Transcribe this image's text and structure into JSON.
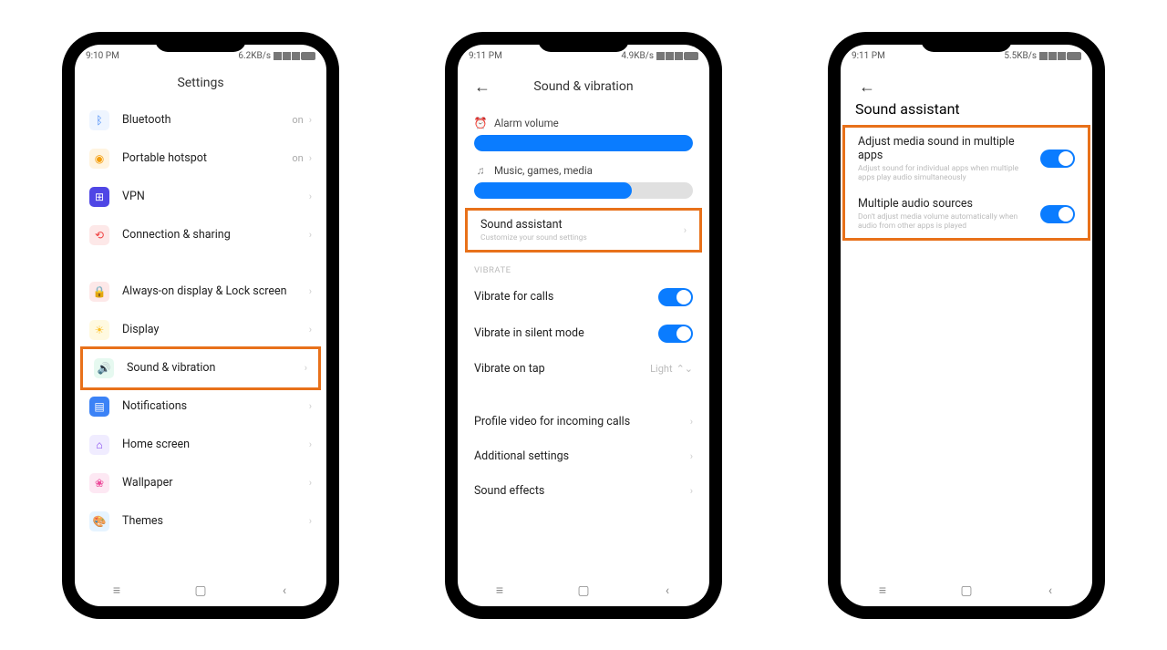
{
  "phone1": {
    "status": {
      "time": "9:10 PM",
      "net": "6.2KB/s"
    },
    "title": "Settings",
    "items": [
      {
        "icon": "📶",
        "color": "#3b82f6",
        "label": "Bluetooth",
        "value": "on"
      },
      {
        "icon": "📡",
        "color": "#f59e0b",
        "label": "Portable hotspot",
        "value": "on"
      },
      {
        "icon": "🔑",
        "color": "#4f46e5",
        "label": "VPN",
        "value": ""
      },
      {
        "icon": "🔗",
        "color": "#ef4444",
        "label": "Connection & sharing",
        "value": ""
      },
      {
        "icon": "🔒",
        "color": "#ef4444",
        "label": "Always-on display & Lock screen",
        "value": ""
      },
      {
        "icon": "☀",
        "color": "#fbbf24",
        "label": "Display",
        "value": ""
      },
      {
        "icon": "🔊",
        "color": "#10b981",
        "label": "Sound & vibration",
        "value": ""
      },
      {
        "icon": "▤",
        "color": "#3b82f6",
        "label": "Notifications",
        "value": ""
      },
      {
        "icon": "⌂",
        "color": "#7c3aed",
        "label": "Home screen",
        "value": ""
      },
      {
        "icon": "❀",
        "color": "#ec4899",
        "label": "Wallpaper",
        "value": ""
      },
      {
        "icon": "▼",
        "color": "#0ea5e9",
        "label": "Themes",
        "value": ""
      }
    ]
  },
  "phone2": {
    "status": {
      "time": "9:11 PM",
      "net": "4.9KB/s"
    },
    "title": "Sound & vibration",
    "alarm_label": "Alarm volume",
    "media_label": "Music, games, media",
    "alarm_pct": 100,
    "media_pct": 72,
    "sound_assistant": {
      "label": "Sound assistant",
      "sub": "Customize your sound settings"
    },
    "vibrate_section": "VIBRATE",
    "vibrate_calls": "Vibrate for calls",
    "vibrate_silent": "Vibrate in silent mode",
    "vibrate_tap": {
      "label": "Vibrate on tap",
      "value": "Light"
    },
    "profile_video": "Profile video for incoming calls",
    "additional": "Additional settings",
    "sound_effects": "Sound effects"
  },
  "phone3": {
    "status": {
      "time": "9:11 PM",
      "net": "5.5KB/s"
    },
    "title": "Sound assistant",
    "item1": {
      "label": "Adjust media sound in multiple apps",
      "sub": "Adjust sound for individual apps when multiple apps play audio simultaneously"
    },
    "item2": {
      "label": "Multiple audio sources",
      "sub": "Don't adjust media volume automatically when audio from other apps is played"
    }
  }
}
